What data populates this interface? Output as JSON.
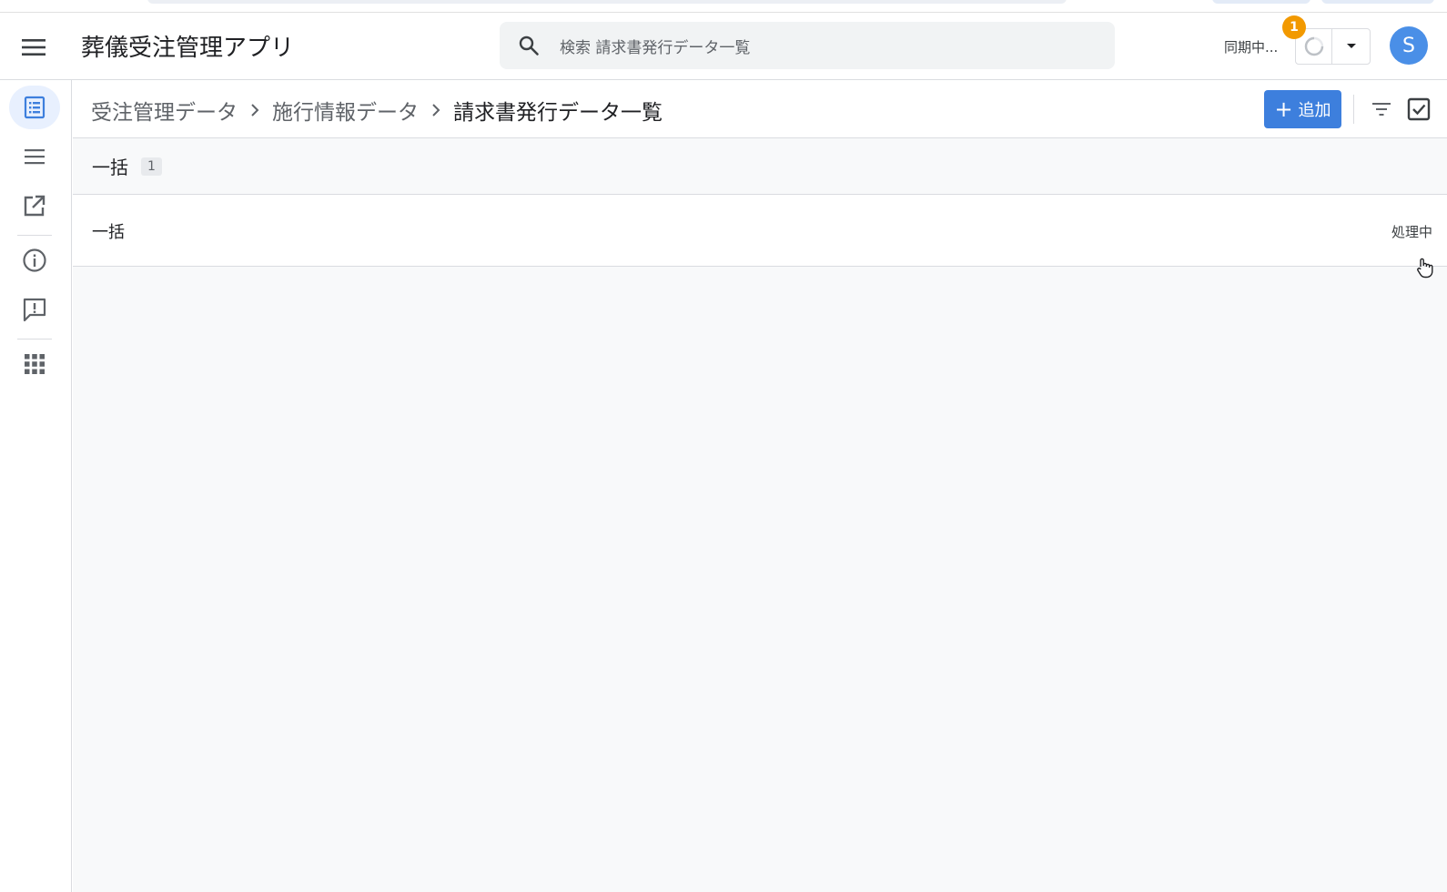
{
  "app": {
    "title": "葬儀受注管理アプリ"
  },
  "search": {
    "placeholder": "検索 請求書発行データ一覧"
  },
  "sync": {
    "label": "同期中...",
    "badge_count": "1"
  },
  "user": {
    "avatar_initial": "S"
  },
  "breadcrumb": {
    "items": [
      "受注管理データ",
      "施行情報データ",
      "請求書発行データ一覧"
    ]
  },
  "toolbar": {
    "add_label": "追加"
  },
  "group": {
    "title": "一括",
    "count": "1"
  },
  "rows": [
    {
      "title": "一括",
      "status": "処理中"
    }
  ],
  "sidenav": {
    "items": [
      "list-view-icon",
      "menu-lines-icon",
      "open-external-icon",
      "info-icon",
      "feedback-icon",
      "apps-grid-icon"
    ]
  },
  "colors": {
    "accent": "#3d7fdd",
    "avatar": "#4a8fe7",
    "badge": "#f29900"
  }
}
